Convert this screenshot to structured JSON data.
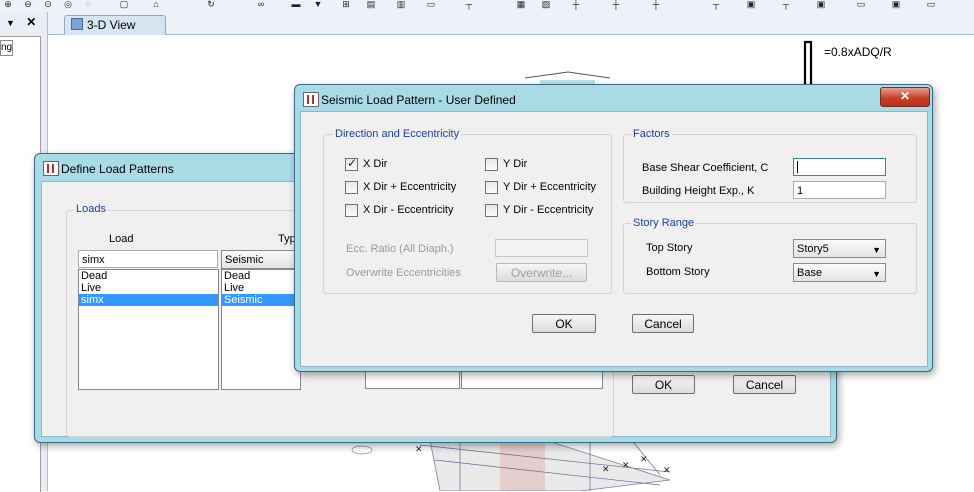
{
  "app": {
    "view_tab_label": "3-D View",
    "left_panel_tab": "ng"
  },
  "annotation": "=0.8xADQ/R",
  "define_dialog": {
    "title": "Define Load Patterns",
    "loads_group": "Loads",
    "col_load": "Load",
    "col_type": "Typ",
    "load_input": "simx",
    "type_input": "Seismic",
    "loads": [
      "Dead",
      "Live",
      "simx"
    ],
    "types": [
      "Dead",
      "Live",
      "Seismic"
    ],
    "selected_index": 2,
    "ok_label": "OK",
    "cancel_label": "Cancel"
  },
  "seismic_dialog": {
    "title": "Seismic Load Pattern - User Defined",
    "direction_group": "Direction and Eccentricity",
    "x_dir": "X Dir",
    "x_dir_plus": "X Dir + Eccentricity",
    "x_dir_minus": "X Dir - Eccentricity",
    "y_dir": "Y Dir",
    "y_dir_plus": "Y Dir + Eccentricity",
    "y_dir_minus": "Y Dir - Eccentricity",
    "x_dir_checked": true,
    "ecc_ratio_label": "Ecc. Ratio (All Diaph.)",
    "overwrite_label": "Overwrite Eccentricities",
    "overwrite_button": "Overwrite...",
    "factors_group": "Factors",
    "base_shear_label": "Base Shear Coefficient, C",
    "base_shear_value": "",
    "height_exp_label": "Building Height Exp., K",
    "height_exp_value": "1",
    "story_group": "Story Range",
    "top_story_label": "Top Story",
    "top_story_value": "Story5",
    "bottom_story_label": "Bottom Story",
    "bottom_story_value": "Base",
    "ok_label": "OK",
    "cancel_label": "Cancel"
  },
  "colors": {
    "dialog_frame": "#a9dbe7",
    "legend_text": "#1a3ea8",
    "selection": "#3399ff",
    "close_button": "#c8412a"
  }
}
